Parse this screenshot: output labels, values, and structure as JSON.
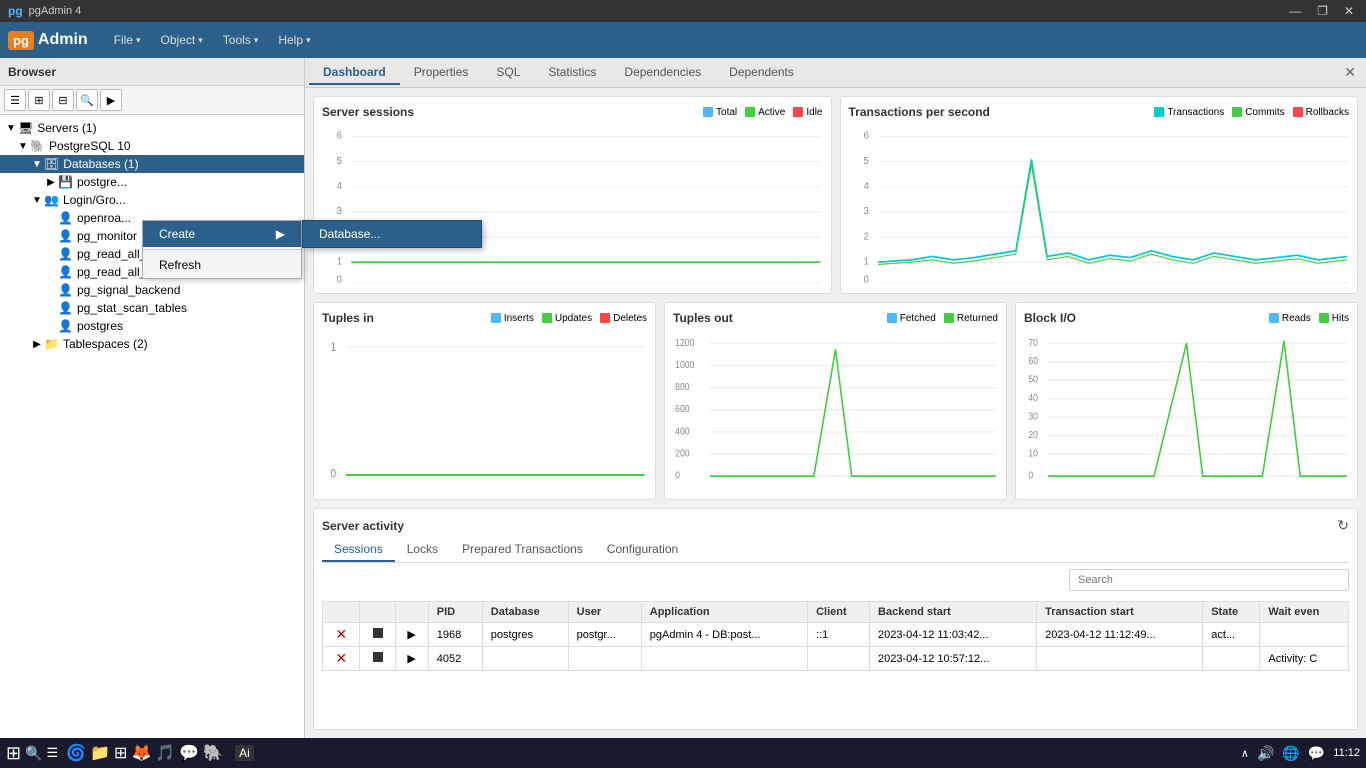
{
  "app": {
    "title": "pgAdmin 4",
    "logo": "pgAdmin",
    "logo_box": "pg"
  },
  "titlebar": {
    "title": "pgAdmin 4",
    "minimize": "—",
    "maximize": "❐",
    "close": "✕"
  },
  "menubar": {
    "items": [
      {
        "label": "File",
        "has_arrow": true
      },
      {
        "label": "Object",
        "has_arrow": true
      },
      {
        "label": "Tools",
        "has_arrow": true
      },
      {
        "label": "Help",
        "has_arrow": true
      }
    ]
  },
  "browser": {
    "title": "Browser",
    "toolbar_buttons": [
      "☰",
      "⊞",
      "⊟",
      "🔍",
      "▶"
    ],
    "tree": [
      {
        "level": 0,
        "toggle": "▼",
        "icon": "🖥",
        "label": "Servers (1)",
        "indent": 0
      },
      {
        "level": 1,
        "toggle": "▼",
        "icon": "🐘",
        "label": "PostgreSQL 10",
        "indent": 1
      },
      {
        "level": 2,
        "toggle": "▼",
        "icon": "🗄",
        "label": "Databases (1)",
        "indent": 2,
        "selected": true
      },
      {
        "level": 3,
        "toggle": "▶",
        "icon": "💾",
        "label": "postgre...",
        "indent": 3
      },
      {
        "level": 2,
        "toggle": "▼",
        "icon": "👥",
        "label": "Login/Gro...",
        "indent": 2
      },
      {
        "level": 3,
        "toggle": "",
        "icon": "👤",
        "label": "openroa...",
        "indent": 3
      },
      {
        "level": 3,
        "toggle": "",
        "icon": "👤",
        "label": "pg_monitor",
        "indent": 3
      },
      {
        "level": 3,
        "toggle": "",
        "icon": "👤",
        "label": "pg_read_all_settings",
        "indent": 3
      },
      {
        "level": 3,
        "toggle": "",
        "icon": "👤",
        "label": "pg_read_all_stats",
        "indent": 3
      },
      {
        "level": 3,
        "toggle": "",
        "icon": "👤",
        "label": "pg_signal_backend",
        "indent": 3
      },
      {
        "level": 3,
        "toggle": "",
        "icon": "👤",
        "label": "pg_stat_scan_tables",
        "indent": 3
      },
      {
        "level": 3,
        "toggle": "",
        "icon": "👤",
        "label": "postgres",
        "indent": 3
      },
      {
        "level": 2,
        "toggle": "▶",
        "icon": "📁",
        "label": "Tablespaces (2)",
        "indent": 2
      }
    ]
  },
  "context_menu": {
    "items": [
      {
        "label": "Create",
        "has_arrow": true,
        "active": true
      },
      {
        "label": "Refresh",
        "has_arrow": false
      }
    ]
  },
  "submenu": {
    "items": [
      {
        "label": "Database..."
      }
    ]
  },
  "content": {
    "tabs": [
      {
        "label": "Dashboard",
        "active": true
      },
      {
        "label": "Properties"
      },
      {
        "label": "SQL"
      },
      {
        "label": "Statistics"
      },
      {
        "label": "Dependencies"
      },
      {
        "label": "Dependents"
      }
    ]
  },
  "charts": {
    "server_sessions": {
      "title": "Server sessions",
      "legend": [
        {
          "color": "#4db8ff",
          "label": "Total"
        },
        {
          "color": "#44cc44",
          "label": "Active"
        },
        {
          "color": "#ff4444",
          "label": "Idle"
        }
      ],
      "y_labels": [
        "6",
        "5",
        "4",
        "3",
        "2",
        "1",
        "0"
      ],
      "line_color": "#44cc44"
    },
    "transactions": {
      "title": "Transactions per second",
      "legend": [
        {
          "color": "#00cccc",
          "label": "Transactions"
        },
        {
          "color": "#44cc44",
          "label": "Commits"
        },
        {
          "color": "#ff4444",
          "label": "Rollbacks"
        }
      ],
      "y_labels": [
        "6",
        "5",
        "4",
        "3",
        "2",
        "1",
        "0"
      ]
    },
    "tuples_in": {
      "title": "Tuples in",
      "legend": [
        {
          "color": "#4db8ff",
          "label": "Inserts"
        },
        {
          "color": "#44cc44",
          "label": "Updates"
        },
        {
          "color": "#ff4444",
          "label": "Deletes"
        }
      ],
      "y_labels": [
        "1",
        "0"
      ]
    },
    "tuples_out": {
      "title": "Tuples out",
      "legend": [
        {
          "color": "#4db8ff",
          "label": "Fetched"
        },
        {
          "color": "#44cc44",
          "label": "Returned"
        }
      ],
      "y_labels": [
        "1200",
        "1000",
        "800",
        "600",
        "400",
        "200",
        "0"
      ]
    },
    "block_io": {
      "title": "Block I/O",
      "legend": [
        {
          "color": "#4db8ff",
          "label": "Reads"
        },
        {
          "color": "#44cc44",
          "label": "Hits"
        }
      ],
      "y_labels": [
        "70",
        "60",
        "50",
        "40",
        "30",
        "20",
        "10",
        "0"
      ]
    }
  },
  "server_activity": {
    "title": "Server activity",
    "refresh_icon": "↻",
    "tabs": [
      {
        "label": "Sessions",
        "active": true
      },
      {
        "label": "Locks"
      },
      {
        "label": "Prepared Transactions"
      },
      {
        "label": "Configuration"
      }
    ],
    "search_placeholder": "Search",
    "table": {
      "columns": [
        "",
        "",
        "",
        "PID",
        "Database",
        "User",
        "Application",
        "Client",
        "Backend start",
        "Transaction start",
        "State",
        "Wait even"
      ],
      "rows": [
        {
          "terminate": "✕",
          "stop": "■",
          "play": "▶",
          "pid": "1968",
          "database": "postgres",
          "user": "postgr...",
          "application": "pgAdmin 4 - DB:post...",
          "client": "::1",
          "backend_start": "2023-04-12 11:03:42...",
          "transaction_start": "2023-04-12 11:12:49...",
          "state": "act...",
          "wait_event": ""
        },
        {
          "terminate": "✕",
          "stop": "■",
          "play": "▶",
          "pid": "4052",
          "database": "",
          "user": "",
          "application": "",
          "client": "",
          "backend_start": "2023-04-12 10:57:12...",
          "transaction_start": "",
          "state": "",
          "wait_event": "Activity: C"
        }
      ]
    }
  },
  "taskbar": {
    "start_icon": "⊞",
    "search_icon": "🔍",
    "task_view": "❑",
    "tray": {
      "time": "11:12",
      "date": "",
      "icons": [
        "∧",
        "🔊",
        "🌐",
        "💬"
      ]
    },
    "app_label": "Ai",
    "pinned_apps": [
      "⊞",
      "🔍",
      "☰",
      "🌀",
      "🦊",
      "🎵",
      "💬",
      "🐘"
    ]
  }
}
